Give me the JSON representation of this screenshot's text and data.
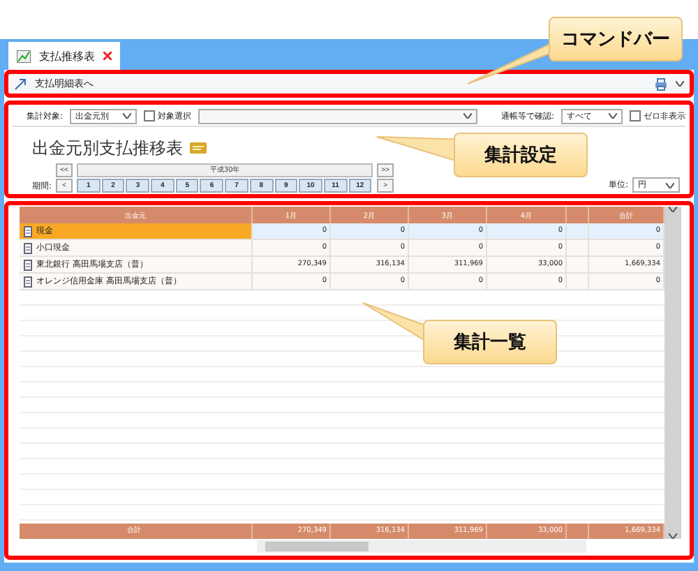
{
  "tabs": [
    {
      "label": "支払推移表",
      "selected": true
    }
  ],
  "command_bar": {
    "link": "支払明細表へ"
  },
  "settings": {
    "target_label": "集計対象:",
    "target_value": "出金元別",
    "select_label": "対象選択",
    "select_checked": false,
    "passbook_label": "通帳等で確認:",
    "passbook_value": "すべて",
    "zero_label": "ゼロ非表示",
    "zero_checked": false,
    "title": "出金元別支払推移表",
    "period_label": "期間:",
    "year": "平成30年",
    "first": "<<",
    "prev": "<",
    "next": ">",
    "last": ">>",
    "months": [
      "1",
      "2",
      "3",
      "4",
      "5",
      "6",
      "7",
      "8",
      "9",
      "10",
      "11",
      "12"
    ],
    "unit_label": "単位:",
    "unit_value": "円"
  },
  "table": {
    "columns": [
      "出金元",
      "1月",
      "2月",
      "3月",
      "4月",
      "",
      "合計"
    ],
    "rows": [
      {
        "name": "現金",
        "values": [
          "0",
          "0",
          "0",
          "0",
          "0"
        ],
        "selected": true
      },
      {
        "name": "小口現金",
        "values": [
          "0",
          "0",
          "0",
          "0",
          "0"
        ],
        "selected": false
      },
      {
        "name": "東北銀行 高田馬場支店（普）",
        "values": [
          "270,349",
          "316,134",
          "311,969",
          "33,000",
          "1,669,334"
        ],
        "selected": false
      },
      {
        "name": "オレンジ信用金庫 高田馬場支店（普）",
        "values": [
          "0",
          "0",
          "0",
          "0",
          "0"
        ],
        "selected": false
      }
    ],
    "total": {
      "label": "合計",
      "values": [
        "270,349",
        "316,134",
        "311,969",
        "33,000",
        "1,669,334"
      ]
    }
  },
  "callouts": [
    {
      "text": "コマンドバー"
    },
    {
      "text": "集計設定"
    },
    {
      "text": "集計一覧"
    }
  ]
}
